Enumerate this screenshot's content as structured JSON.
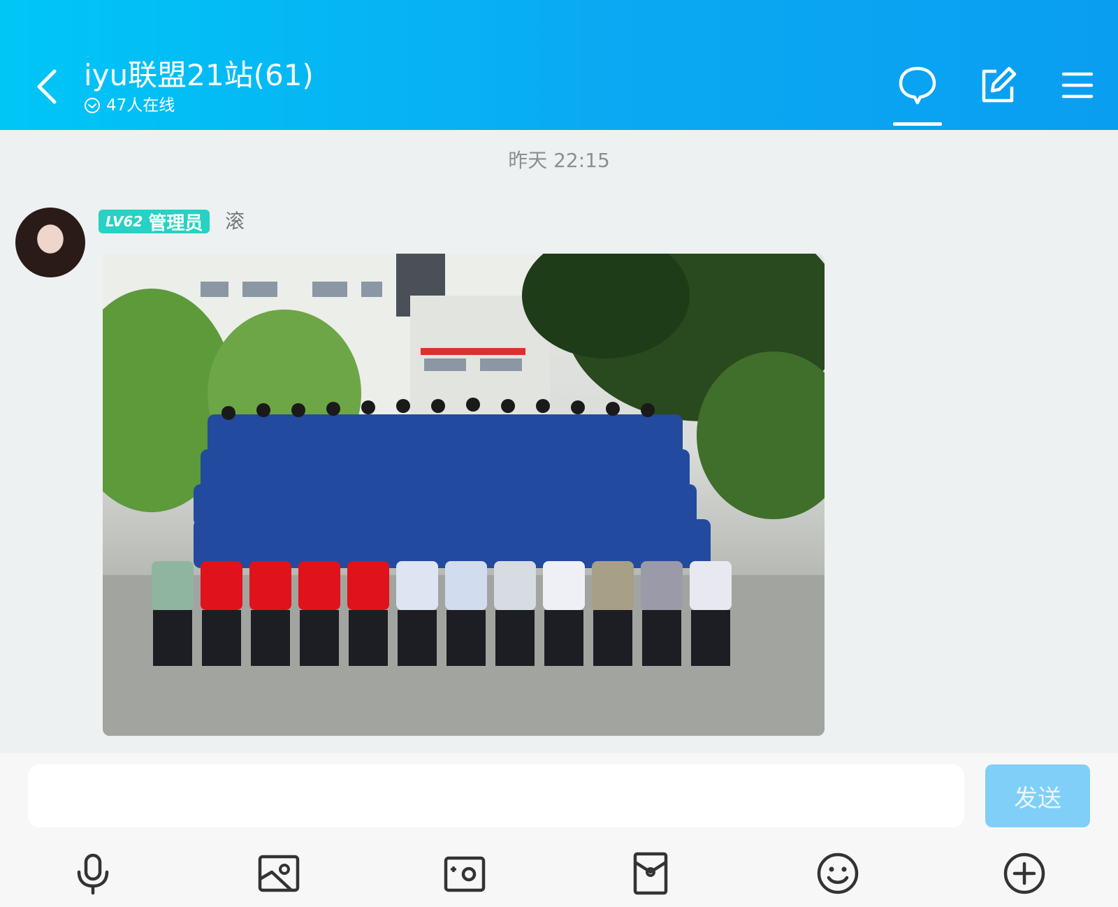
{
  "header": {
    "title": "iyu联盟21站(61)",
    "online_status": "47人在线",
    "icons": [
      "back-icon",
      "online-check-icon",
      "chat-bubble-icon",
      "edit-icon",
      "menu-icon"
    ],
    "colors": {
      "gradient_start": "#00c6f6",
      "gradient_end": "#0a9ef1"
    }
  },
  "chat": {
    "timestamp": "昨天 22:15",
    "message": {
      "level_badge": "LV62",
      "role_badge": "管理员",
      "badge_color": "#27d1c3",
      "nickname": "滚",
      "content_type": "image"
    }
  },
  "composer": {
    "input_value": "",
    "send_label": "发送",
    "send_color": "#80cff8",
    "tools": [
      "microphone-icon",
      "image-icon",
      "camera-icon",
      "red-packet-icon",
      "emoji-icon",
      "plus-icon"
    ]
  }
}
